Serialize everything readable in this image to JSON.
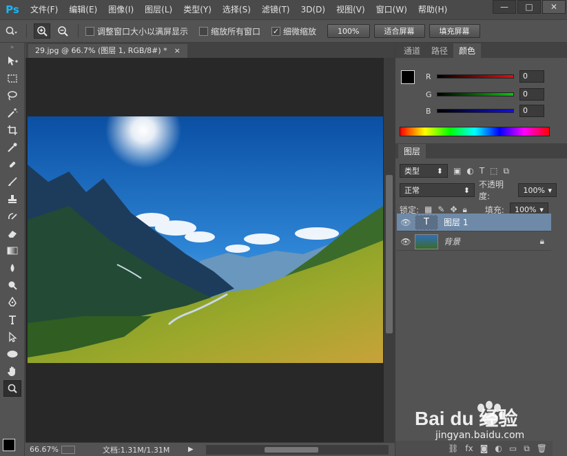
{
  "app": {
    "logo": "Ps"
  },
  "menu": [
    "文件(F)",
    "编辑(E)",
    "图像(I)",
    "图层(L)",
    "类型(Y)",
    "选择(S)",
    "滤镜(T)",
    "3D(D)",
    "视图(V)",
    "窗口(W)",
    "帮助(H)"
  ],
  "window_controls": {
    "minimize": "—",
    "maximize": "□",
    "close": "✕"
  },
  "options": {
    "resize_windows_label": "调整窗口大小以满屏显示",
    "resize_windows_checked": false,
    "zoom_all_label": "缩放所有窗口",
    "zoom_all_checked": false,
    "scrubby_zoom_label": "细微缩放",
    "scrubby_zoom_checked": true,
    "actual_pixels_label": "100%",
    "fit_screen_label": "适合屏幕",
    "fill_screen_label": "填充屏幕"
  },
  "document": {
    "tab_title": "29.jpg @ 66.7% (图层 1, RGB/8#) *",
    "tab_close": "×"
  },
  "status": {
    "zoom": "66.67%",
    "doc_info": "文档:1.31M/1.31M"
  },
  "color_panel": {
    "tabs": [
      "通道",
      "路径",
      "颜色"
    ],
    "active_tab": "颜色",
    "r_label": "R",
    "r_value": "0",
    "g_label": "G",
    "g_value": "0",
    "b_label": "B",
    "b_value": "0",
    "r_color": "#e01010",
    "g_color": "#10c010",
    "b_color": "#1010e0"
  },
  "layers_panel": {
    "tab": "图层",
    "filter_kind": "类型",
    "blend_mode": "正常",
    "opacity_label": "不透明度:",
    "opacity_value": "100%",
    "lock_label": "锁定:",
    "fill_label": "填充:",
    "fill_value": "100%",
    "layers": [
      {
        "name": "图层 1",
        "type": "text",
        "selected": true
      },
      {
        "name": "背景",
        "type": "image",
        "locked": true
      }
    ]
  },
  "watermark": {
    "brand": "Bai du 经验",
    "url": "jingyan.baidu.com"
  }
}
